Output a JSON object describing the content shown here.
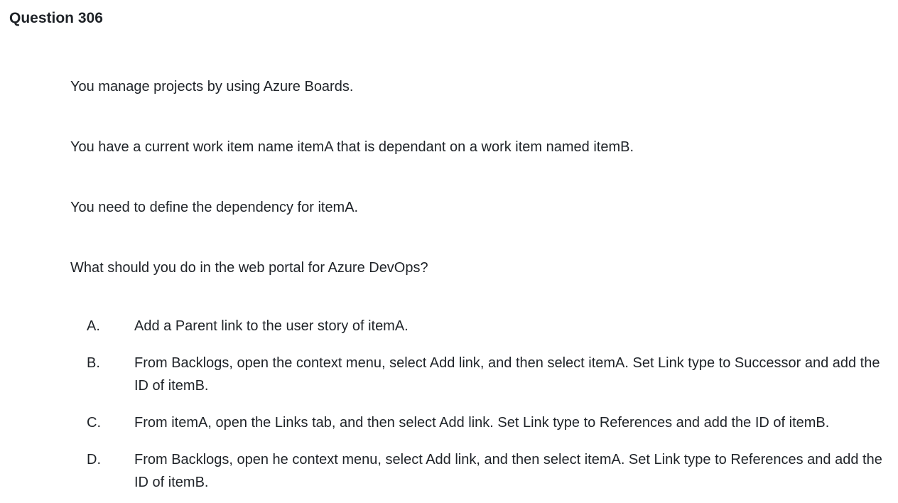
{
  "question": {
    "title": "Question 306"
  },
  "stem": [
    "You manage projects by using Azure Boards.",
    "You have a current work item name itemA that is dependant on a work item named itemB.",
    "You need to define the dependency for itemA.",
    "What should you do in the web portal for Azure DevOps?"
  ],
  "options": [
    {
      "letter": "A.",
      "text": "Add a Parent link to the user story of itemA."
    },
    {
      "letter": "B.",
      "text": "From Backlogs, open the context menu, select Add link, and then select itemA. Set Link type to Successor and add the ID of itemB."
    },
    {
      "letter": "C.",
      "text": "From itemA, open the Links tab, and then select Add link. Set Link type to References and add the ID of itemB."
    },
    {
      "letter": "D.",
      "text": "From Backlogs, open he context menu, select Add link, and then select itemA. Set Link type to References and add the ID of itemB."
    }
  ]
}
